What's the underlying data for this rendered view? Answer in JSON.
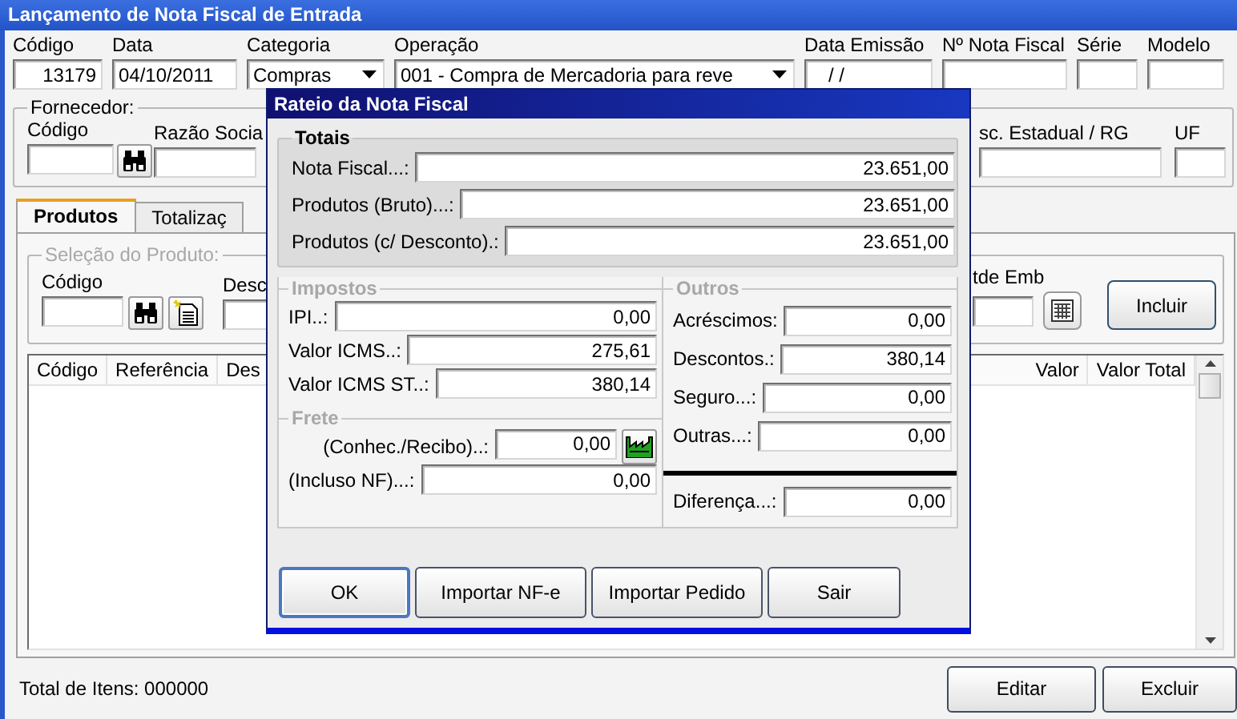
{
  "window": {
    "title": "Lançamento de Nota Fiscal de Entrada"
  },
  "header_fields": [
    {
      "label": "Código",
      "kind": "number",
      "value": "13179"
    },
    {
      "label": "Data",
      "kind": "text",
      "value": "04/10/2011"
    },
    {
      "label": "Categoria",
      "kind": "select",
      "value": "Compras"
    },
    {
      "label": "Operação",
      "kind": "select",
      "value": "001 - Compra de Mercadoria para reve"
    },
    {
      "label": "Data Emissão",
      "kind": "date",
      "value": "/ /"
    },
    {
      "label": "Nº Nota Fiscal",
      "kind": "text"
    },
    {
      "label": "Série",
      "kind": "text"
    },
    {
      "label": "Modelo",
      "kind": "text"
    }
  ],
  "supplier": {
    "legend": "Fornecedor:",
    "fields": [
      {
        "label": "Código",
        "kind": "lookup"
      },
      {
        "label": "Razão Socia",
        "kind": "text"
      },
      {
        "label": "sc. Estadual / RG",
        "kind": "text"
      },
      {
        "label": "UF",
        "kind": "text"
      }
    ]
  },
  "tabs": [
    {
      "label": "Produtos",
      "selected": true
    },
    {
      "label": "Totalizaç",
      "selected": false
    }
  ],
  "product_selection": {
    "legend": "Seleção do Produto:",
    "disabled": true,
    "fields": [
      {
        "label": "Código",
        "kind": "lookup_new"
      },
      {
        "label": "Desc",
        "kind": "text"
      },
      {
        "label": "tde Emb",
        "kind": "calc"
      }
    ],
    "button": "Incluir"
  },
  "items_grid": {
    "columns": [
      "Código",
      "Referência",
      "Des",
      "Valor",
      "Valor Total"
    ]
  },
  "footer": {
    "total": "Total de Itens: 000000",
    "buttons": [
      "Editar",
      "Excluir"
    ]
  },
  "dialog": {
    "title": "Rateio da Nota Fiscal",
    "totals": {
      "legend": "Totais",
      "disabled": false,
      "rows": [
        {
          "label": "Nota Fiscal...:",
          "value": "23.651,00"
        },
        {
          "label": "Produtos (Bruto)...:",
          "value": "23.651,00"
        },
        {
          "label": "Produtos (c/ Desconto).:",
          "value": "23.651,00"
        }
      ]
    },
    "taxes": {
      "legend": "Impostos",
      "disabled": true,
      "rows": [
        {
          "label": "IPI..:",
          "value": "0,00"
        },
        {
          "label": "Valor ICMS..:",
          "value": "275,61"
        },
        {
          "label": "Valor ICMS ST..:",
          "value": "380,14"
        }
      ]
    },
    "freight": {
      "legend": "Frete",
      "disabled": true,
      "rows": [
        {
          "label": "(Conhec./Recibo)..:",
          "value": "0,00",
          "kind": "factory"
        },
        {
          "label": "(Incluso NF)...:",
          "value": "0,00",
          "kind": "plain"
        }
      ]
    },
    "others": {
      "legend": "Outros",
      "disabled": true,
      "rows": [
        {
          "label": "Acréscimos:",
          "value": "0,00"
        },
        {
          "label": "Descontos.:",
          "value": "380,14"
        },
        {
          "label": "Seguro...:",
          "value": "0,00"
        },
        {
          "label": "Outras...:",
          "value": "0,00"
        }
      ]
    },
    "difference": {
      "label": "Diferença...:",
      "value": "0,00"
    },
    "buttons": [
      {
        "label": "OK",
        "focused": true
      },
      {
        "label": "Importar NF-e",
        "focused": false
      },
      {
        "label": "Importar Pedido",
        "focused": false
      },
      {
        "label": "Sair",
        "focused": false
      }
    ]
  }
}
